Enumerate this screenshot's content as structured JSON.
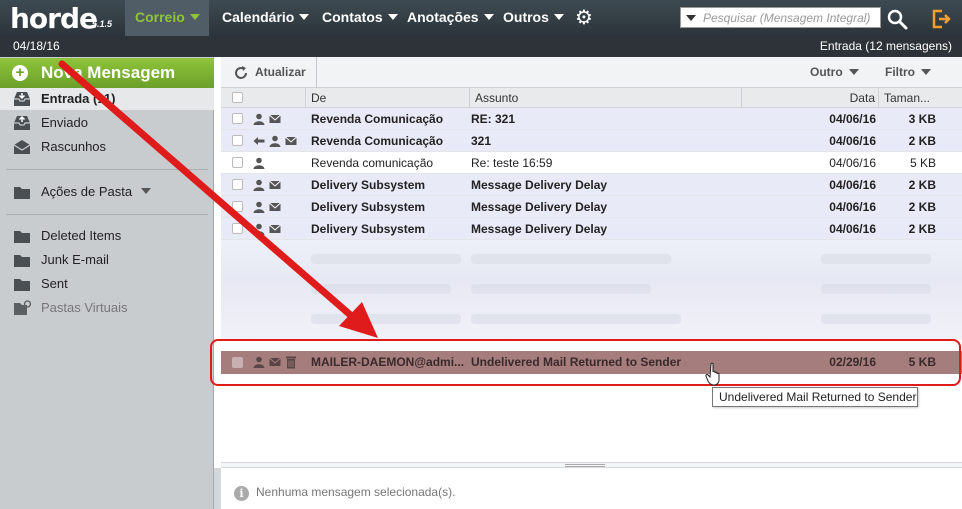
{
  "app": {
    "logo": "horde",
    "version": "5.1.5"
  },
  "nav": {
    "items": [
      {
        "label": "Correio"
      },
      {
        "label": "Calendário"
      },
      {
        "label": "Contatos"
      },
      {
        "label": "Anotações"
      },
      {
        "label": "Outros"
      }
    ],
    "settings_icon": "gear-icon",
    "search_placeholder": "Pesquisar (Mensagem Integral)",
    "search_icon": "search-icon",
    "logout_icon": "logout-icon"
  },
  "subbar": {
    "date": "04/18/16",
    "status": "Entrada (12 mensagens)"
  },
  "sidebar": {
    "new_message": "Nova Mensagem",
    "folders": [
      {
        "label": "Entrada (11)",
        "icon": "inbox-icon"
      },
      {
        "label": "Enviado",
        "icon": "sent-icon"
      },
      {
        "label": "Rascunhos",
        "icon": "drafts-icon"
      }
    ],
    "folder_actions": "Ações de Pasta",
    "extra_folders": [
      {
        "label": "Deleted Items",
        "icon": "folder-icon"
      },
      {
        "label": "Junk E-mail",
        "icon": "folder-icon"
      },
      {
        "label": "Sent",
        "icon": "folder-icon"
      },
      {
        "label": "Pastas Virtuais",
        "icon": "virtual-folder-icon"
      }
    ]
  },
  "toolbar": {
    "refresh": "Atualizar",
    "other": "Outro",
    "filter": "Filtro"
  },
  "list": {
    "columns": {
      "from": "De",
      "subject": "Assunto",
      "date": "Data",
      "size": "Taman..."
    },
    "rows": [
      {
        "from": "Revenda Comunicação",
        "subject": "RE: 321",
        "date": "04/06/16",
        "size": "3 KB"
      },
      {
        "from": "Revenda Comunicação",
        "subject": "321",
        "date": "04/06/16",
        "size": "2 KB"
      },
      {
        "from": "Revenda comunicação",
        "subject": "Re: teste 16:59",
        "date": "04/06/16",
        "size": "5 KB"
      },
      {
        "from": "Delivery Subsystem",
        "subject": "Message Delivery Delay",
        "date": "04/06/16",
        "size": "2 KB"
      },
      {
        "from": "Delivery Subsystem",
        "subject": "Message Delivery Delay",
        "date": "04/06/16",
        "size": "2 KB"
      },
      {
        "from": "Delivery Subsystem",
        "subject": "Message Delivery Delay",
        "date": "04/06/16",
        "size": "2 KB"
      }
    ],
    "deleted_row": {
      "from": "MAILER-DAEMON@admi...",
      "subject": "Undelivered Mail Returned to Sender",
      "date": "02/29/16",
      "size": "5 KB"
    }
  },
  "tooltip": "Undelivered Mail Returned to Sender",
  "preview": {
    "empty_text": "Nenhuma mensagem selecionada(s)."
  },
  "colors": {
    "accent_green": "#8fc43a",
    "topbar": "#2b343a",
    "unseen_row": "#e8eaf8",
    "deleted_row": "#a57d7d",
    "annotation_red": "#e01b1b"
  }
}
